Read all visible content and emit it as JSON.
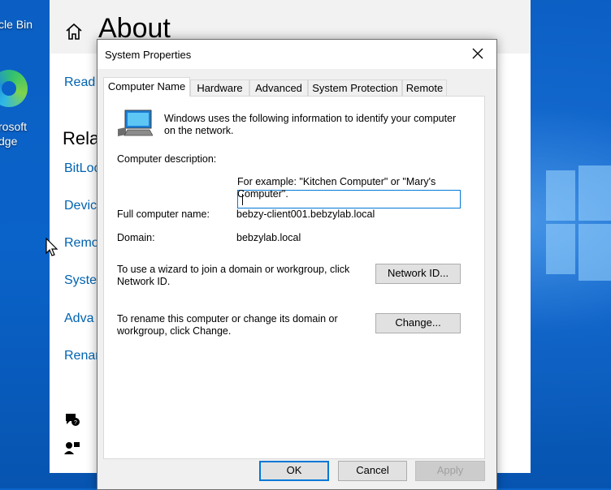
{
  "desktop": {
    "recycle_bin_label": "cle Bin",
    "edge_label_1": "rosoft",
    "edge_label_2": "dge"
  },
  "settings": {
    "page_title": "About",
    "read_link": "Read",
    "related_heading": "Rela",
    "links": [
      "BitLoc",
      "Devic",
      "Remo",
      "Syste",
      "Adva",
      "Renar"
    ]
  },
  "dialog": {
    "title": "System Properties",
    "tabs": [
      "Computer Name",
      "Hardware",
      "Advanced",
      "System Protection",
      "Remote"
    ],
    "active_tab": "Computer Name",
    "intro_text": "Windows uses the following information to identify your computer on the network.",
    "description_label": "Computer description:",
    "description_value": "",
    "example_text": "For example: \"Kitchen Computer\" or \"Mary's Computer\".",
    "full_name_label": "Full computer name:",
    "full_name_value": "bebzy-client001.bebzylab.local",
    "domain_label": "Domain:",
    "domain_value": "bebzylab.local",
    "wizard_text": "To use a wizard to join a domain or workgroup, click Network ID.",
    "network_id_button": "Network ID...",
    "rename_text": "To rename this computer or change its domain or workgroup, click Change.",
    "change_button": "Change...",
    "ok_button": "OK",
    "cancel_button": "Cancel",
    "apply_button": "Apply"
  },
  "colors": {
    "desktop_blue": "#0a63c9",
    "link_blue": "#0063b1",
    "focus_blue": "#0078d7"
  }
}
